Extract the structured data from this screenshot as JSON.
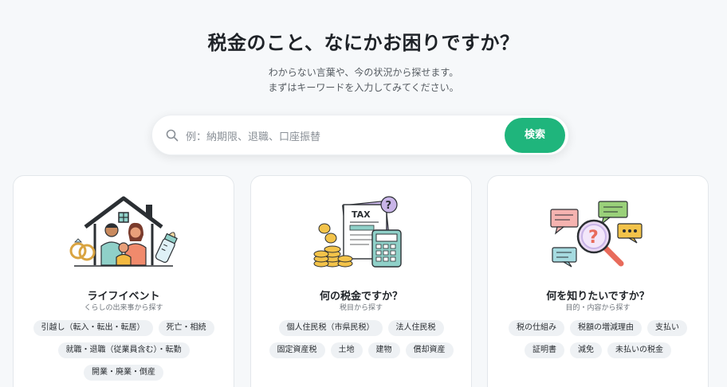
{
  "hero": {
    "title": "税金のこと、なにかお困りですか？",
    "subtitle_line1": "わからない言葉や、今の状況から探せます。",
    "subtitle_line2": "まずはキーワードを入力してみてください。"
  },
  "search": {
    "placeholder": "例：納期限、退職、口座振替",
    "button_label": "検索",
    "accent": "#1fb57c"
  },
  "cards": [
    {
      "title": "ライフイベント",
      "caption": "くらしの出来事から探す",
      "tag_rows": [
        [
          "引越し（転入・転出・転居）",
          "死亡・相続"
        ],
        [
          "就職・退職（従業員含む）・転勤"
        ],
        [
          "開業・廃業・倒産"
        ]
      ]
    },
    {
      "title": "何の税金ですか？",
      "caption": "税目から探す",
      "illustration_label": "TAX",
      "tag_rows": [
        [
          "個人住民税（市県民税）",
          "法人住民税"
        ],
        [
          "固定資産税",
          "土地",
          "建物",
          "償却資産"
        ]
      ]
    },
    {
      "title": "何を知りたいですか？",
      "caption": "目的・内容から探す",
      "tag_rows": [
        [
          "税の仕組み",
          "税額の増減理由",
          "支払い"
        ],
        [
          "証明書",
          "減免",
          "未払いの税金"
        ]
      ]
    }
  ]
}
